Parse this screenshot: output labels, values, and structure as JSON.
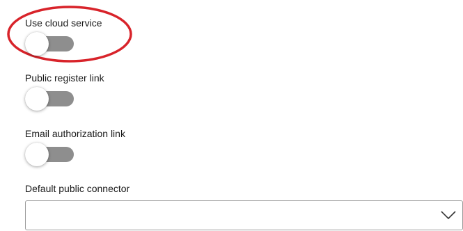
{
  "settings": {
    "cloud_service": {
      "label": "Use cloud service",
      "enabled": false
    },
    "public_register_link": {
      "label": "Public register link",
      "enabled": false
    },
    "email_authorization_link": {
      "label": "Email authorization link",
      "enabled": false
    }
  },
  "default_public_connector": {
    "label": "Default public connector",
    "value": "",
    "icon": "chevron-down-icon"
  },
  "colors": {
    "toggle_track_off": "#8e8e8e",
    "highlight_ring": "#d8232a"
  }
}
